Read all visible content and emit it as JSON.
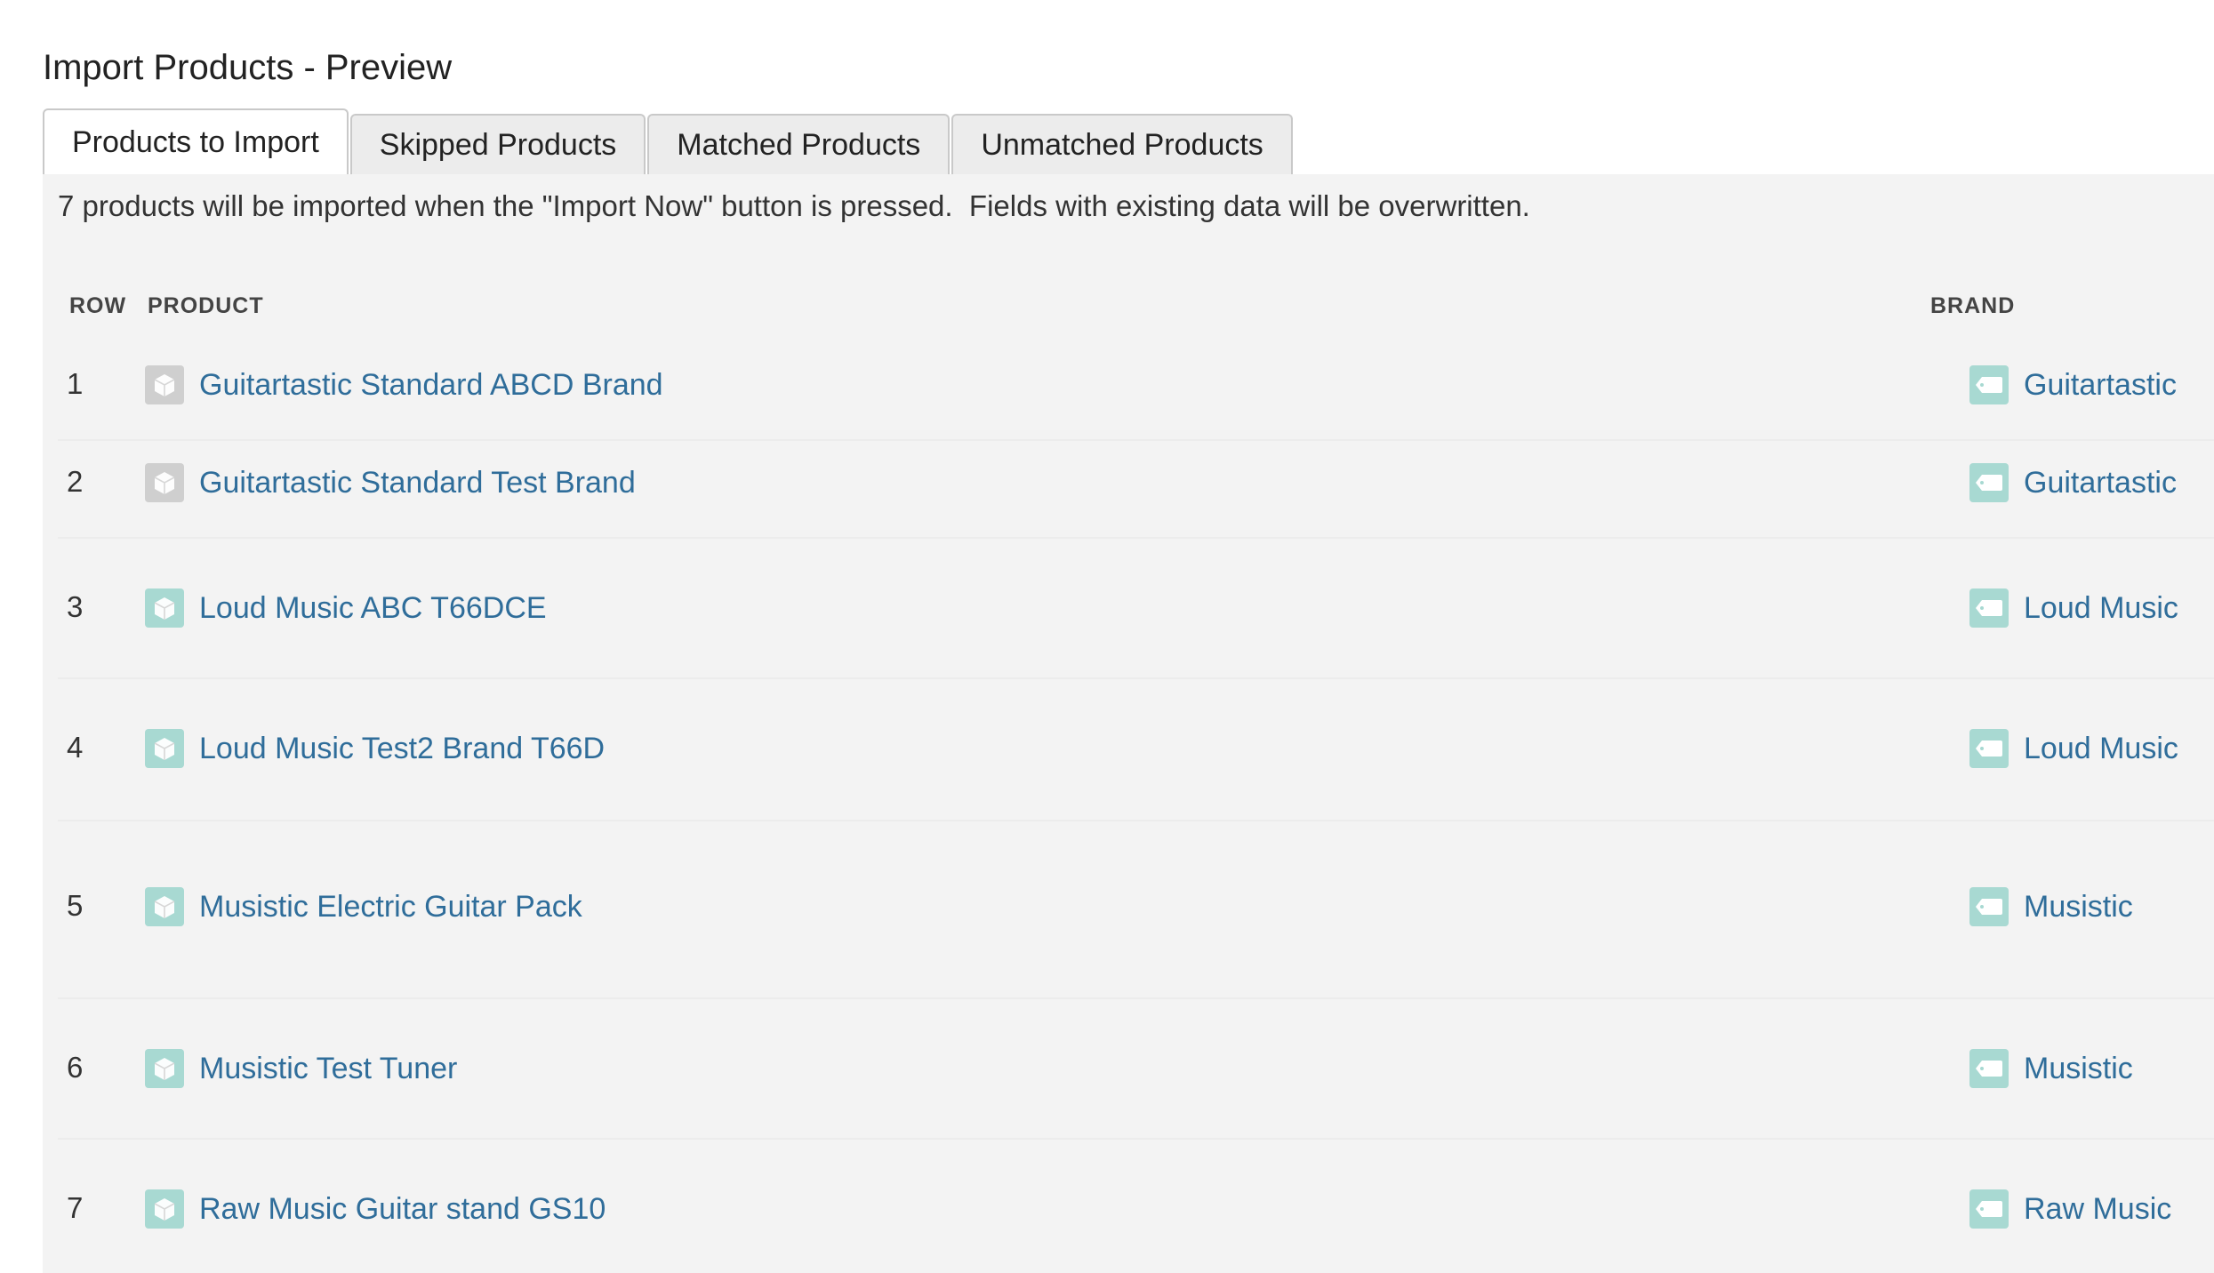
{
  "page": {
    "title": "Import Products - Preview"
  },
  "tabs": [
    {
      "label": "Products to Import",
      "active": true
    },
    {
      "label": "Skipped Products",
      "active": false
    },
    {
      "label": "Matched Products",
      "active": false
    },
    {
      "label": "Unmatched Products",
      "active": false
    }
  ],
  "notice": "7 products will be imported when the \"Import Now\" button is pressed.  Fields with existing data will be overwritten.",
  "table": {
    "headers": {
      "row": "ROW",
      "product": "PRODUCT",
      "brand": "BRAND"
    },
    "rows": [
      {
        "row": "1",
        "product": "Guitartastic Standard ABCD Brand",
        "product_icon": "product-box-icon",
        "product_icon_color": "#cfcfcf",
        "brand": "Guitartastic",
        "brand_icon": "brand-tag-icon"
      },
      {
        "row": "2",
        "product": "Guitartastic Standard Test Brand",
        "product_icon": "product-box-icon",
        "product_icon_color": "#cfcfcf",
        "brand": "Guitartastic",
        "brand_icon": "brand-tag-icon"
      },
      {
        "row": "3",
        "product": "Loud Music ABC T66DCE",
        "product_icon": "product-box-icon",
        "product_icon_color": "#a8d9d2",
        "brand": "Loud Music",
        "brand_icon": "brand-tag-icon"
      },
      {
        "row": "4",
        "product": "Loud Music Test2 Brand T66D",
        "product_icon": "product-box-icon",
        "product_icon_color": "#a8d9d2",
        "brand": "Loud Music",
        "brand_icon": "brand-tag-icon"
      },
      {
        "row": "5",
        "product": "Musistic Electric Guitar Pack",
        "product_icon": "product-box-icon",
        "product_icon_color": "#a8d9d2",
        "brand": "Musistic",
        "brand_icon": "brand-tag-icon"
      },
      {
        "row": "6",
        "product": "Musistic Test Tuner",
        "product_icon": "product-box-icon",
        "product_icon_color": "#a8d9d2",
        "brand": "Musistic",
        "brand_icon": "brand-tag-icon"
      },
      {
        "row": "7",
        "product": "Raw Music Guitar stand GS10",
        "product_icon": "product-box-icon",
        "product_icon_color": "#a8d9d2",
        "brand": "Raw Music",
        "brand_icon": "brand-tag-icon"
      }
    ]
  },
  "colors": {
    "link": "#2f6d9a",
    "panel_background": "#f3f3f3",
    "brand_icon": "#a8d9d2",
    "inactive_product_icon": "#cfcfcf"
  }
}
